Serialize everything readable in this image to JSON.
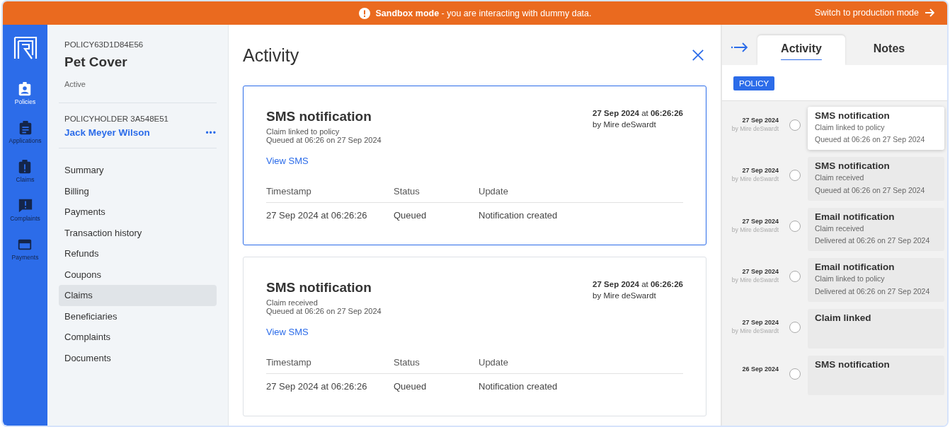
{
  "banner": {
    "title": "Sandbox mode",
    "message": " - you are interacting with dummy data.",
    "action": "Switch to production mode"
  },
  "rail": [
    {
      "label": "Policies",
      "kind": "badge"
    },
    {
      "label": "Applications",
      "kind": "clipboard"
    },
    {
      "label": "Claims",
      "kind": "alert"
    },
    {
      "label": "Complaints",
      "kind": "chat"
    },
    {
      "label": "Payments",
      "kind": "card"
    }
  ],
  "policy": {
    "id": "POLICY63D1D84E56",
    "name": "Pet Cover",
    "status": "Active"
  },
  "policyholder": {
    "label": "POLICYHOLDER 3A548E51",
    "name": "Jack Meyer Wilson",
    "more": "•••"
  },
  "nav": [
    {
      "label": "Summary",
      "selected": false
    },
    {
      "label": "Billing",
      "selected": false
    },
    {
      "label": "Payments",
      "selected": false
    },
    {
      "label": "Transaction history",
      "selected": false
    },
    {
      "label": "Refunds",
      "selected": false
    },
    {
      "label": "Coupons",
      "selected": false
    },
    {
      "label": "Claims",
      "selected": true
    },
    {
      "label": "Beneficiaries",
      "selected": false
    },
    {
      "label": "Complaints",
      "selected": false
    },
    {
      "label": "Documents",
      "selected": false
    }
  ],
  "main": {
    "title": "Activity",
    "cards": [
      {
        "title": "SMS notification",
        "subtitle": "Claim linked to policy",
        "detail": "Queued at 06:26 on 27 Sep 2024",
        "date": "**27 Sep 2024** at **06:26:26**",
        "by": "by Mire deSwardt",
        "link": "View SMS",
        "selected": true,
        "columns": [
          "Timestamp",
          "Status",
          "Update"
        ],
        "rows": [
          [
            "27 Sep 2024 at 06:26:26",
            "Queued",
            "Notification created"
          ]
        ]
      },
      {
        "title": "SMS notification",
        "subtitle": "Claim received",
        "detail": "Queued at 06:26 on 27 Sep 2024",
        "date": "**27 Sep 2024** at **06:26:26**",
        "by": "by Mire deSwardt",
        "link": "View SMS",
        "selected": false,
        "columns": [
          "Timestamp",
          "Status",
          "Update"
        ],
        "rows": [
          [
            "27 Sep 2024 at 06:26:26",
            "Queued",
            "Notification created"
          ]
        ]
      }
    ]
  },
  "side": {
    "tabs": [
      {
        "label": "Activity",
        "selected": true
      },
      {
        "label": "Notes",
        "selected": false
      }
    ],
    "filter": "POLICY",
    "timeline": [
      {
        "date": "27 Sep 2024",
        "by": "by Mire deSwardt",
        "title": "SMS notification",
        "lines": [
          "Claim linked to policy",
          "Queued at 06:26 on 27 Sep 2024"
        ],
        "selected": true
      },
      {
        "date": "27 Sep 2024",
        "by": "by Mire deSwardt",
        "title": "SMS notification",
        "lines": [
          "Claim received",
          "Queued at 06:26 on 27 Sep 2024"
        ],
        "selected": false
      },
      {
        "date": "27 Sep 2024",
        "by": "by Mire deSwardt",
        "title": "Email notification",
        "lines": [
          "Claim received",
          "Delivered at 06:26 on 27 Sep 2024"
        ],
        "selected": false
      },
      {
        "date": "27 Sep 2024",
        "by": "by Mire deSwardt",
        "title": "Email notification",
        "lines": [
          "Claim linked to policy",
          "Delivered at 06:26 on 27 Sep 2024"
        ],
        "selected": false
      },
      {
        "date": "27 Sep 2024",
        "by": "by Mire deSwardt",
        "title": "Claim linked",
        "selected": false
      },
      {
        "date": "26 Sep 2024",
        "title": "SMS notification",
        "selected": false
      }
    ]
  }
}
